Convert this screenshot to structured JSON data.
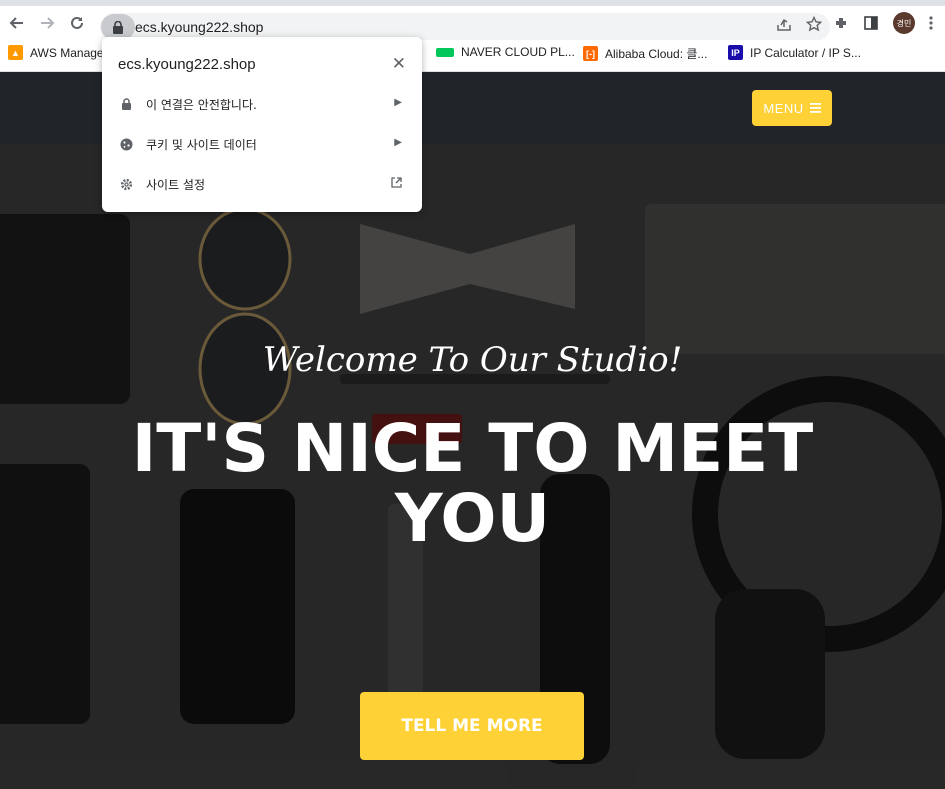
{
  "browser": {
    "url": "ecs.kyoung222.shop",
    "profile_initials": "경민"
  },
  "bookmarks": [
    {
      "label": "AWS Manage",
      "icon": "aws-icon",
      "color": "#ff9900"
    },
    {
      "label": "NAVER CLOUD PL...",
      "icon": "naver-cloud-icon",
      "color": "#03c75a"
    },
    {
      "label": "Alibaba Cloud: 클...",
      "icon": "alibaba-cloud-icon",
      "color": "#ff6a00"
    },
    {
      "label": "IP Calculator / IP S...",
      "icon": "ip-calculator-icon",
      "color": "#1a0dab"
    }
  ],
  "popup": {
    "title": "ecs.kyoung222.shop",
    "items": [
      {
        "label": "이 연결은 안전합니다.",
        "icon": "lock-icon"
      },
      {
        "label": "쿠키 및 사이트 데이터",
        "icon": "cookie-icon"
      },
      {
        "label": "사이트 설정",
        "icon": "gear-icon"
      }
    ]
  },
  "site": {
    "menu_label": "MENU",
    "subheading": "Welcome To Our Studio!",
    "heading": "IT'S NICE TO MEET YOU",
    "cta_label": "TELL ME MORE",
    "accent_color": "#fed136"
  }
}
